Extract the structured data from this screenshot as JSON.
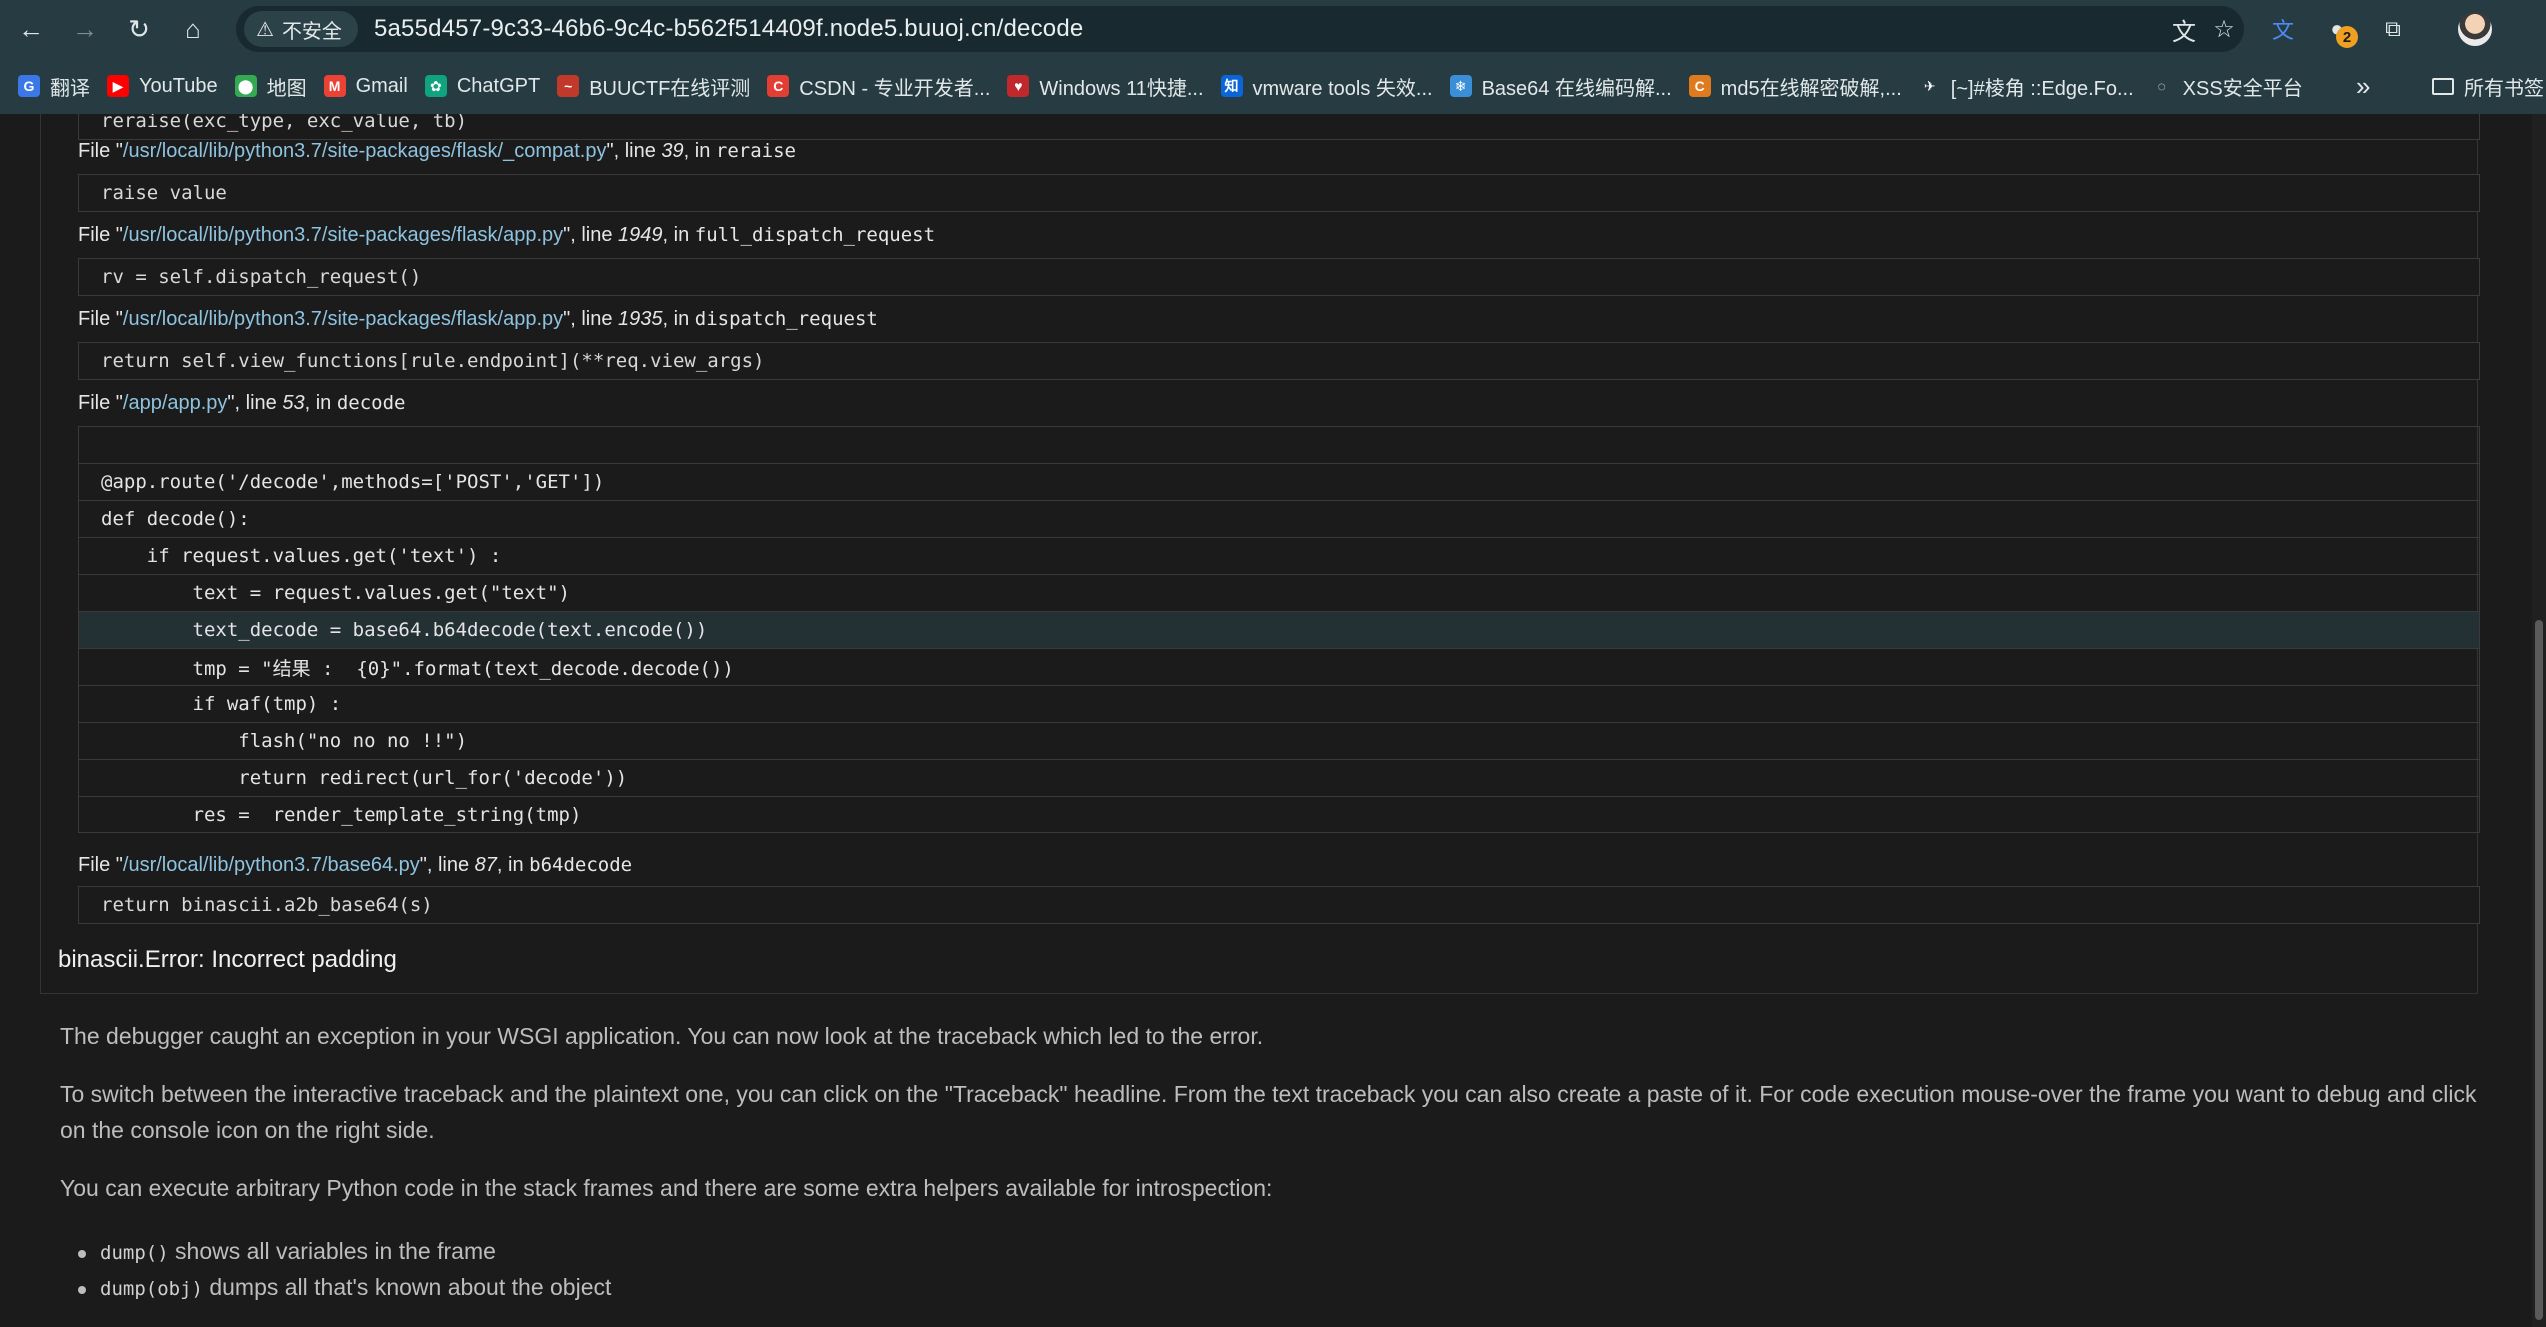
{
  "browser": {
    "security_label": "不安全",
    "url": "5a55d457-9c33-46b6-9c4c-b562f514409f.node5.buuoj.cn/decode",
    "extension_badge": "2",
    "bookmarks": [
      {
        "label": "翻译",
        "icon": "translate-icon",
        "color": "#3b78e7",
        "glyph": "G"
      },
      {
        "label": "YouTube",
        "icon": "youtube-icon",
        "color": "#ff0000",
        "glyph": "▶"
      },
      {
        "label": "地图",
        "icon": "maps-icon",
        "color": "#34a853",
        "glyph": "⬤"
      },
      {
        "label": "Gmail",
        "icon": "gmail-icon",
        "color": "#ea4335",
        "glyph": "M"
      },
      {
        "label": "ChatGPT",
        "icon": "chatgpt-icon",
        "color": "#10a37f",
        "glyph": "✿"
      },
      {
        "label": "BUUCTF在线评测",
        "icon": "buuctf-icon",
        "color": "#c0392b",
        "glyph": "~"
      },
      {
        "label": "CSDN - 专业开发者...",
        "icon": "csdn-icon",
        "color": "#e33e33",
        "glyph": "C"
      },
      {
        "label": "Windows 11快捷...",
        "icon": "windows-shortcut-icon",
        "color": "#c0282d",
        "glyph": "♥"
      },
      {
        "label": "vmware tools 失效...",
        "icon": "zhihu-icon",
        "color": "#0a66d8",
        "glyph": "知"
      },
      {
        "label": "Base64 在线编码解...",
        "icon": "base64-icon",
        "color": "#3a8fd8",
        "glyph": "❄"
      },
      {
        "label": "md5在线解密破解,...",
        "icon": "md5-icon",
        "color": "#e07a1f",
        "glyph": "C"
      },
      {
        "label": "[~]#棱角 ::Edge.Fo...",
        "icon": "edge-forum-icon",
        "color": "#263c42",
        "glyph": "✈"
      },
      {
        "label": "XSS安全平台",
        "icon": "xss-platform-icon",
        "color": "#263c42",
        "glyph": "◌"
      }
    ],
    "overflow_label": "»",
    "all_bookmarks": "所有书签"
  },
  "traceback": {
    "partial_top": "reraise(exc_type, exc_value, tb)",
    "frames": [
      {
        "prefix": "File \"",
        "path": "/usr/local/lib/python3.7/site-packages/flask/_compat.py",
        "mid": "\", line ",
        "line": "39",
        "sep": ", in ",
        "func": "reraise",
        "code": "raise value"
      },
      {
        "prefix": "File \"",
        "path": "/usr/local/lib/python3.7/site-packages/flask/app.py",
        "mid": "\", line ",
        "line": "1949",
        "sep": ", in ",
        "func": "full_dispatch_request",
        "code": "rv = self.dispatch_request()"
      },
      {
        "prefix": "File \"",
        "path": "/usr/local/lib/python3.7/site-packages/flask/app.py",
        "mid": "\", line ",
        "line": "1935",
        "sep": ", in ",
        "func": "dispatch_request",
        "code": "return self.view_functions[rule.endpoint](**req.view_args)"
      },
      {
        "prefix": "File \"",
        "path": "/app/app.py",
        "mid": "\", line ",
        "line": "53",
        "sep": ", in ",
        "func": "decode",
        "code": ""
      },
      {
        "prefix": "File \"",
        "path": "/usr/local/lib/python3.7/base64.py",
        "mid": "\", line ",
        "line": "87",
        "sep": ", in ",
        "func": "b64decode",
        "code": "return binascii.a2b_base64(s)"
      }
    ],
    "source_lines": [
      "",
      "@app.route('/decode',methods=['POST','GET'])",
      "def decode():",
      "    if request.values.get('text') :",
      "        text = request.values.get(\"text\")",
      "        text_decode = base64.b64decode(text.encode())",
      "        tmp = \"结果 :  {0}\".format(text_decode.decode())",
      "        if waf(tmp) :",
      "            flash(\"no no no !!\")",
      "            return redirect(url_for('decode'))",
      "        res =  render_template_string(tmp)"
    ],
    "current_line_index": 5,
    "error_type": "binascii.Error",
    "error_message": ": Incorrect padding"
  },
  "explanation": {
    "p1": "The debugger caught an exception in your WSGI application. You can now look at the traceback which led to the error.",
    "p2": "To switch between the interactive traceback and the plaintext one, you can click on the \"Traceback\" headline. From the text traceback you can also create a paste of it. For code execution mouse-over the frame you want to debug and click on the console icon on the right side.",
    "p3": "You can execute arbitrary Python code in the stack frames and there are some extra helpers available for introspection:",
    "helpers": [
      {
        "code": "dump()",
        "text": " shows all variables in the frame"
      },
      {
        "code": "dump(obj)",
        "text": " dumps all that's known about the object"
      }
    ]
  }
}
